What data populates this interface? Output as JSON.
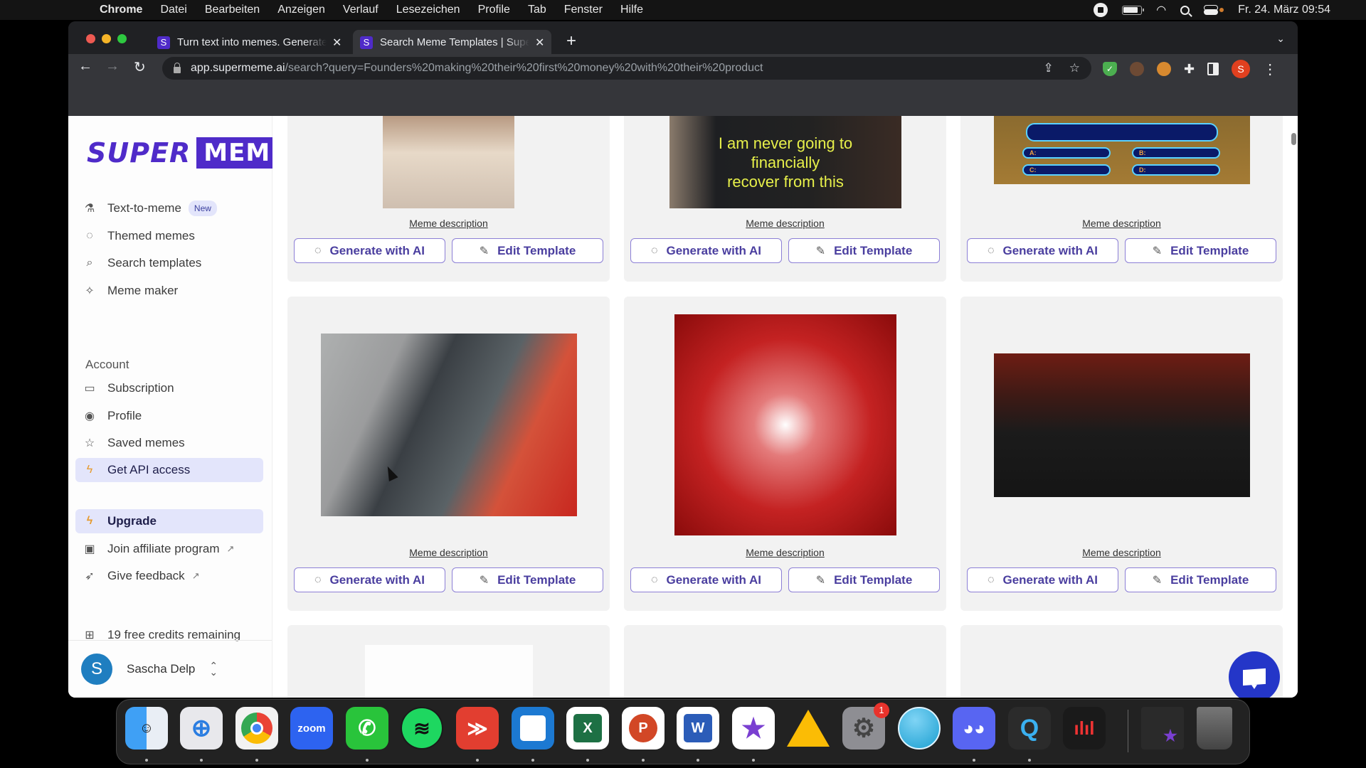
{
  "menubar": {
    "apple_icon": "apple-logo-icon",
    "app_name": "Chrome",
    "menus": [
      "Datei",
      "Bearbeiten",
      "Anzeigen",
      "Verlauf",
      "Lesezeichen",
      "Profile",
      "Tab",
      "Fenster",
      "Hilfe"
    ],
    "status_icons": [
      "screen-record-icon",
      "battery-icon",
      "wifi-icon",
      "spotlight-search-icon",
      "control-center-icon"
    ],
    "clock": "Fr. 24. März  09:54"
  },
  "browser": {
    "tabs": [
      {
        "favicon": "S",
        "title": "Turn text into memes. Generate",
        "active": false
      },
      {
        "favicon": "S",
        "title": "Search Meme Templates | Supe",
        "active": true
      }
    ],
    "new_tab": "+",
    "url_host": "app.supermeme.ai",
    "url_rest": "/search?query=Founders%20making%20their%20first%20money%20with%20their%20product",
    "profile_initial": "S"
  },
  "sidebar": {
    "logo_super": "SUPER",
    "logo_meme": "MEME",
    "nav": [
      {
        "label": "Text-to-meme",
        "icon": "flask-icon",
        "badge": "New"
      },
      {
        "label": "Themed memes",
        "icon": "dashed-circle-icon"
      },
      {
        "label": "Search templates",
        "icon": "search-icon"
      },
      {
        "label": "Meme maker",
        "icon": "sparkles-icon"
      }
    ],
    "account_label": "Account",
    "account": [
      {
        "label": "Subscription",
        "icon": "credit-card-icon"
      },
      {
        "label": "Profile",
        "icon": "user-circle-icon"
      },
      {
        "label": "Saved memes",
        "icon": "star-icon"
      },
      {
        "label": "Get API access",
        "icon": "bolt-icon",
        "highlighted": true
      }
    ],
    "upgrade": "Upgrade",
    "affiliate": "Join affiliate program",
    "feedback": "Give feedback",
    "credits": "19 free credits remaining",
    "user_initial": "S",
    "user_name": "Sascha Delp"
  },
  "cards": {
    "description_label": "Meme description",
    "generate_label": "Generate with AI",
    "edit_label": "Edit Template",
    "recover_caption": [
      "I am never going to",
      "financially",
      "recover from this"
    ],
    "millionaire_answers": [
      "A:",
      "B:",
      "C:",
      "D:"
    ]
  },
  "dock": {
    "apps": [
      "Finder",
      "Safari",
      "Chrome",
      "Zoom",
      "WhatsApp",
      "Spotify",
      "Todoist",
      "Trello",
      "Excel",
      "PowerPoint",
      "Word",
      "iMovie",
      "Google Drive",
      "System Settings",
      "Browser",
      "Discord",
      "QuickTime",
      "Voice Memos"
    ],
    "zoom_label": "zoom",
    "settings_badge": "1"
  }
}
